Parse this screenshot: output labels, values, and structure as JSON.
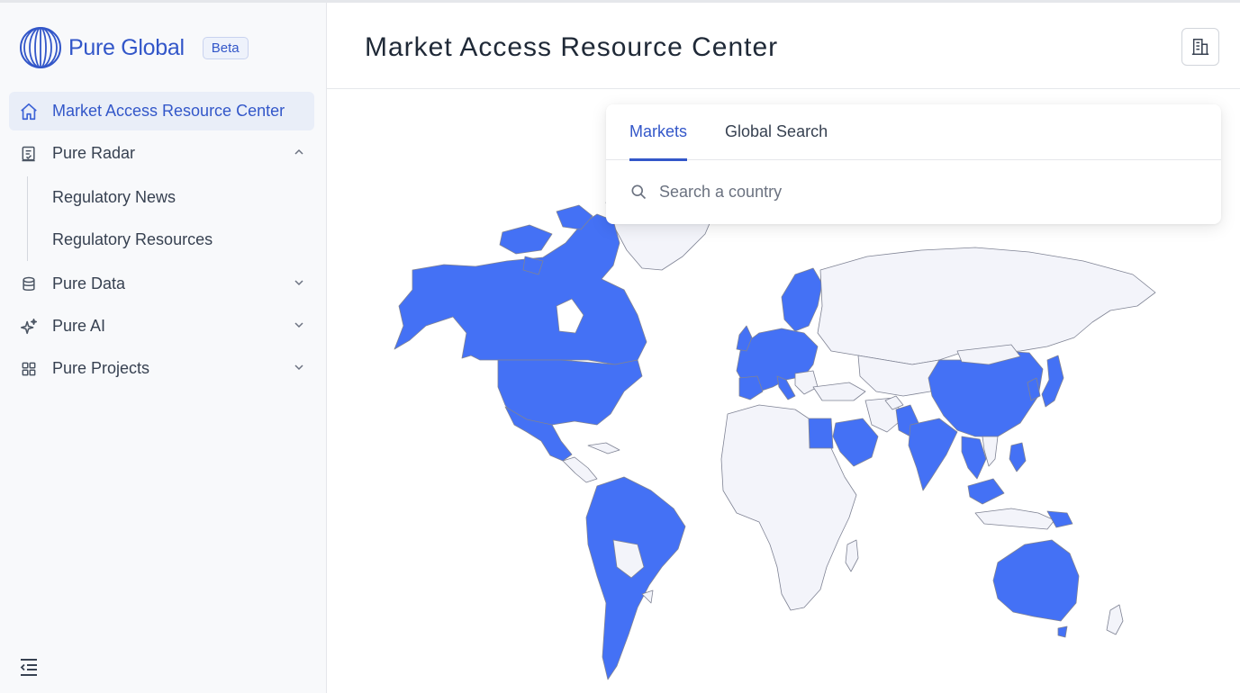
{
  "brand": {
    "name": "Pure Global",
    "badge": "Beta"
  },
  "sidebar": {
    "items": [
      {
        "label": "Market Access Resource Center",
        "icon": "home-icon",
        "active": true
      },
      {
        "label": "Pure Radar",
        "icon": "radar-doc-icon",
        "expanded": true,
        "children": [
          {
            "label": "Regulatory News"
          },
          {
            "label": "Regulatory Resources"
          }
        ]
      },
      {
        "label": "Pure Data",
        "icon": "database-icon",
        "expanded": false
      },
      {
        "label": "Pure AI",
        "icon": "sparkle-icon",
        "expanded": false
      },
      {
        "label": "Pure Projects",
        "icon": "grid-icon",
        "expanded": false
      }
    ],
    "collapse_icon": "collapse-menu-icon"
  },
  "header": {
    "title": "Market Access Resource Center",
    "action_icon": "building-icon"
  },
  "search_card": {
    "tabs": [
      {
        "label": "Markets",
        "active": true
      },
      {
        "label": "Global Search",
        "active": false
      }
    ],
    "search": {
      "placeholder": "Search a country",
      "value": ""
    }
  },
  "colors": {
    "accent": "#3357c9",
    "map_highlight": "#4471f5",
    "map_base": "#f3f4fa",
    "map_border": "#7f8394"
  }
}
